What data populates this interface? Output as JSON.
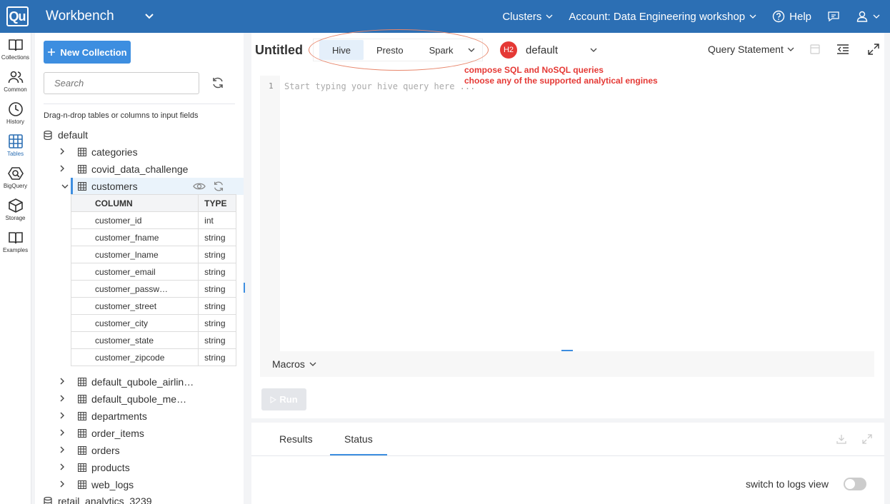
{
  "topbar": {
    "logo": "Qu",
    "app_name": "Workbench",
    "clusters": "Clusters",
    "account": "Account: Data Engineering workshop",
    "help": "Help"
  },
  "rail": [
    {
      "label": "Collections",
      "icon": "book-icon"
    },
    {
      "label": "Common",
      "icon": "users-icon"
    },
    {
      "label": "History",
      "icon": "clock-icon"
    },
    {
      "label": "Tables",
      "icon": "grid-icon",
      "active": true
    },
    {
      "label": "BigQuery",
      "icon": "bigquery-icon"
    },
    {
      "label": "Storage",
      "icon": "cube-icon"
    },
    {
      "label": "Examples",
      "icon": "open-book-icon"
    }
  ],
  "panel": {
    "new_collection": "New Collection",
    "search_placeholder": "Search",
    "dnd_hint": "Drag-n-drop tables or columns to input fields",
    "db_default": "default",
    "db_retail": "retail_analytics_3239",
    "tables_before": [
      "categories",
      "covid_data_challenge"
    ],
    "selected_table": "customers",
    "columns_header": {
      "column": "COLUMN",
      "type": "TYPE"
    },
    "columns": [
      {
        "name": "customer_id",
        "type": "int"
      },
      {
        "name": "customer_fname",
        "type": "string"
      },
      {
        "name": "customer_lname",
        "type": "string"
      },
      {
        "name": "customer_email",
        "type": "string"
      },
      {
        "name": "customer_passw…",
        "type": "string"
      },
      {
        "name": "customer_street",
        "type": "string"
      },
      {
        "name": "customer_city",
        "type": "string"
      },
      {
        "name": "customer_state",
        "type": "string"
      },
      {
        "name": "customer_zipcode",
        "type": "string"
      }
    ],
    "tables_after": [
      "default_qubole_airlin…",
      "default_qubole_me…",
      "departments",
      "order_items",
      "orders",
      "products",
      "web_logs"
    ]
  },
  "editor": {
    "title": "Untitled",
    "engines": [
      "Hive",
      "Presto",
      "Spark"
    ],
    "active_engine": "Hive",
    "cluster_badge": "H2",
    "cluster_name": "default",
    "annotation_line1": "compose SQL and NoSQL queries",
    "annotation_line2": "choose any of the supported analytical engines",
    "query_statement": "Query Statement",
    "line_number": "1",
    "placeholder": "Start typing your hive query here ...",
    "macros": "Macros",
    "run": "Run"
  },
  "results": {
    "tabs": [
      "Results",
      "Status"
    ],
    "active_tab": "Status",
    "switch_label": "switch to logs view"
  },
  "colors": {
    "topbar": "#2c6fb4",
    "accent": "#3d8ee0",
    "annotation": "#e53935"
  }
}
